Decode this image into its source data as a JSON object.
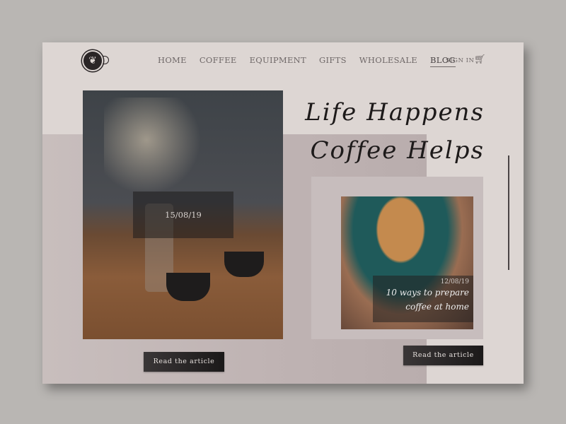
{
  "nav": {
    "items": [
      "HOME",
      "COFFEE",
      "EQUIPMENT",
      "GIFTS",
      "WHOLESALE",
      "BLOG"
    ],
    "active": "BLOG",
    "sign_in": "SIGN IN",
    "cart_icon": "cart-icon",
    "logo_icon": "latte-art-cup-logo"
  },
  "hero": {
    "line1": "Life Happens",
    "line2": "Coffee Helps"
  },
  "posts": [
    {
      "date": "15/08/19",
      "button": "Read the article"
    },
    {
      "date": "12/08/19",
      "title_line1": "10 ways to prepare",
      "title_line2": "coffee at home",
      "button": "Read the article"
    }
  ]
}
